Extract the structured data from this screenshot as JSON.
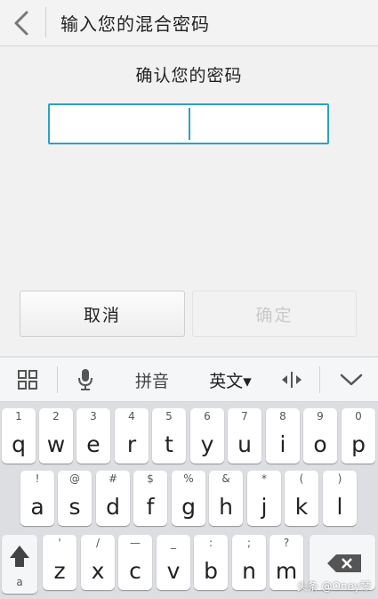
{
  "header": {
    "title": "输入您的混合密码"
  },
  "main": {
    "prompt": "确认您的密码",
    "cancel_label": "取消",
    "ok_label": "确定"
  },
  "keyboard": {
    "toolbar": {
      "pinyin_label": "拼音",
      "english_label": "英文▾"
    },
    "row1": [
      {
        "hint": "1",
        "label": "q"
      },
      {
        "hint": "2",
        "label": "w"
      },
      {
        "hint": "3",
        "label": "e"
      },
      {
        "hint": "4",
        "label": "r"
      },
      {
        "hint": "5",
        "label": "t"
      },
      {
        "hint": "6",
        "label": "y"
      },
      {
        "hint": "7",
        "label": "u"
      },
      {
        "hint": "8",
        "label": "i"
      },
      {
        "hint": "9",
        "label": "o"
      },
      {
        "hint": "0",
        "label": "p"
      }
    ],
    "row2": [
      {
        "hint": "!",
        "label": "a"
      },
      {
        "hint": "@",
        "label": "s"
      },
      {
        "hint": "#",
        "label": "d"
      },
      {
        "hint": "$",
        "label": "f"
      },
      {
        "hint": "%",
        "label": "g"
      },
      {
        "hint": "&",
        "label": "h"
      },
      {
        "hint": "*",
        "label": "j"
      },
      {
        "hint": "(",
        "label": "k"
      },
      {
        "hint": ")",
        "label": "l"
      }
    ],
    "row3": [
      {
        "hint": "'",
        "label": "z"
      },
      {
        "hint": "/",
        "label": "x"
      },
      {
        "hint": "—",
        "label": "c"
      },
      {
        "hint": "_",
        "label": "v"
      },
      {
        "hint": ":",
        "label": "b"
      },
      {
        "hint": ";",
        "label": "n"
      },
      {
        "hint": "?",
        "label": "m"
      }
    ],
    "shift_hint": "a"
  },
  "watermark": "头条 @Oney琴"
}
